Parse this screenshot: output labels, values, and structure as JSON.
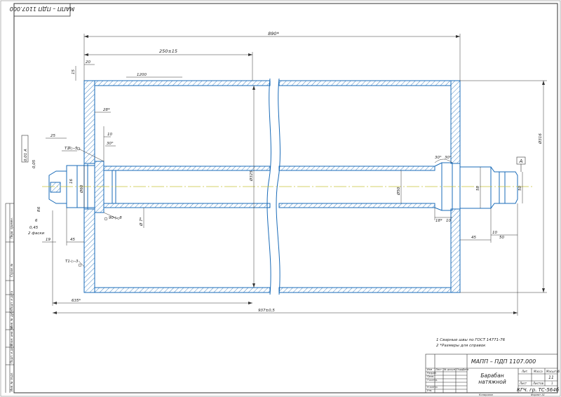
{
  "drawing": {
    "doc_code_rotated": "МАПП – ПДП 1107.000",
    "doc_code": "МАПП – ПДП 1107.000",
    "title_line1": "Барабан",
    "title_line2": "натяжной",
    "sheet_value": "11",
    "group": "КГЧ. гр. ТС-564б",
    "copied_label": "Копировал",
    "format_label": "Формат  А1"
  },
  "dimensions": {
    "total_length": "890*",
    "left_section": "250±15",
    "angle_note": "1200",
    "wall": "20",
    "offset15": "15",
    "len28": "28*",
    "len10": "10",
    "angle30": "30°",
    "dia_outer": "Ø325",
    "dia_right": "Ø316",
    "tube_dia": "Ø50",
    "shaft_dia_left": "Ø60",
    "shaft_dia_right": "58",
    "shaft_small_dia": "50",
    "len25": "25",
    "len7": "7",
    "ch0": "0,05",
    "ch1": "R6",
    "ch2": "6",
    "ch3": "0,45",
    "ch4": "2 фаски",
    "len19": "19",
    "len45": "45",
    "len45r": "45",
    "len635": "635*",
    "total_bottom": "937±0,5",
    "len18": "18*",
    "len10r": "10",
    "len50r": "50",
    "len10b": "10",
    "len16": "16",
    "dia_bottom": "Ø 7*",
    "angle_r1": "30°",
    "angle_r2": "30°",
    "weld1": "Т1-▷-5",
    "weld2": "Т1-▷-3",
    "weld3": "90-▷-8",
    "base_label": "А",
    "tol_frame": "0,01 А",
    "note1": "1  Сварные швы по ГОСТ 14771-76",
    "note2": "2  *Размеры для справок"
  },
  "title_block": {
    "h_izm": "Изм",
    "h_list": "Лист",
    "h_ndoc": "№ докум.",
    "h_podp": "Подп.",
    "h_data": "Дата",
    "r_razrab": "Разраб.",
    "r_prov": "Пров.",
    "r_tkontr": "Т.контр.",
    "r_nkontr": "Н.контр.",
    "r_utv": "Утв.",
    "h_lit": "Лит.",
    "h_massa": "Масса",
    "h_masht": "Масштаб",
    "h_sheet": "Лист",
    "h_sheets": "Листов",
    "sheets_value": "1"
  },
  "side_stamps": [
    "Перв. примен.",
    "Справ. №",
    "Подп. и дата",
    "Инв. № дубл.",
    "Взам. инв. №",
    "Подп. и дата",
    "Инв. № подл."
  ]
}
